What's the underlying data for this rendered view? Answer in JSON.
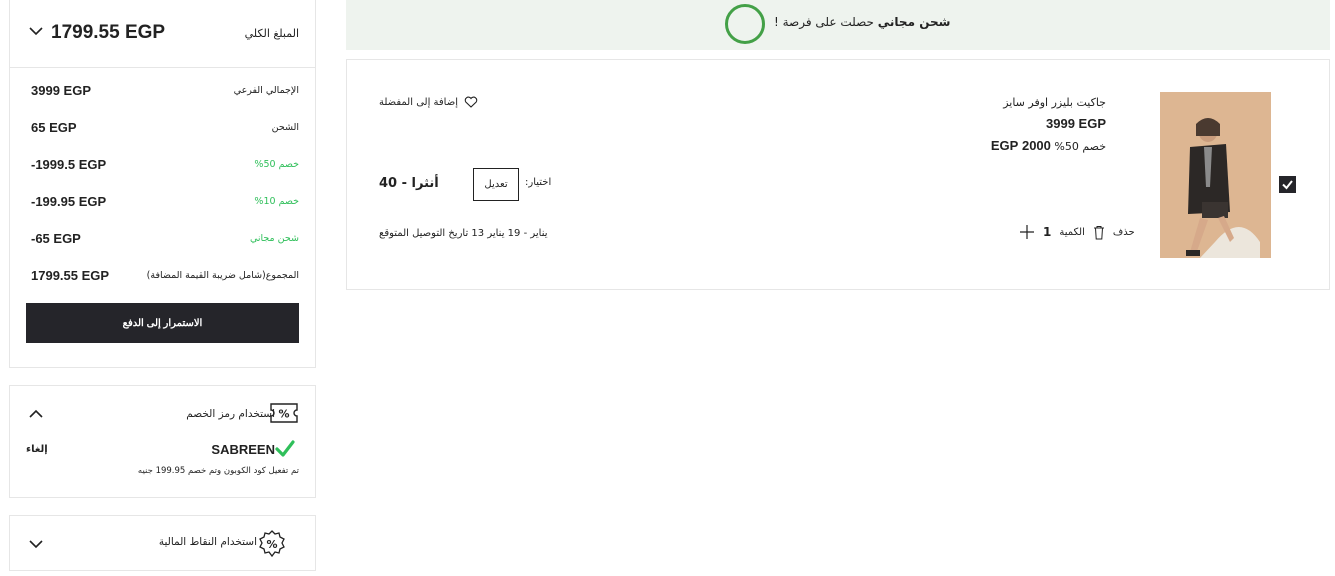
{
  "summary": {
    "total_label": "المبلغ الكلي",
    "total_value": "1799.55 EGP",
    "rows": [
      {
        "label": "الإجمالي الفرعي",
        "value": "3999 EGP",
        "green": false
      },
      {
        "label": "الشحن",
        "value": "65 EGP",
        "green": false
      },
      {
        "label": "خصم 50%",
        "value": "-1999.5 EGP",
        "green": true
      },
      {
        "label": "خصم 10%",
        "value": "-199.95 EGP",
        "green": true
      },
      {
        "label": "شحن مجاني",
        "value": "-65 EGP",
        "green": true
      },
      {
        "label": "المجموع(شامل ضريبة القيمة المضافة)",
        "value": "1799.55 EGP",
        "green": false
      }
    ],
    "pay_button": "الاستمرار إلى الدفع"
  },
  "coupon": {
    "title": "استخدام رمز الخصم",
    "code": "SABREEN",
    "cancel": "إلغاء",
    "note": "تم تفعيل كود الكوبون وتم خصم 199.95 جنيه"
  },
  "points": {
    "title": "استخدام النقاط المالية"
  },
  "banner": {
    "bold": "شحن مجاني",
    "text": "حصلت على فرصة !"
  },
  "product": {
    "name": "جاكيت بليزر اوفر سايز",
    "price": "3999 EGP",
    "discount_label": "خصم 50%",
    "discounted_price": "2000 EGP",
    "wishlist": "إضافة إلى المفضلة",
    "edit": "تعديل",
    "choice_label": "اختيار:",
    "choice_value": "أنثرا - 40",
    "delivery": "يناير - 19 يناير 13 تاريخ التوصيل المتوقع",
    "delete": "حذف",
    "qty_label": "الكمية",
    "qty_value": "1"
  },
  "colors": {
    "accent_dark": "#25252a",
    "green": "#2fbf5a",
    "banner_bg": "#eef3ee",
    "ring": "#43a047"
  }
}
